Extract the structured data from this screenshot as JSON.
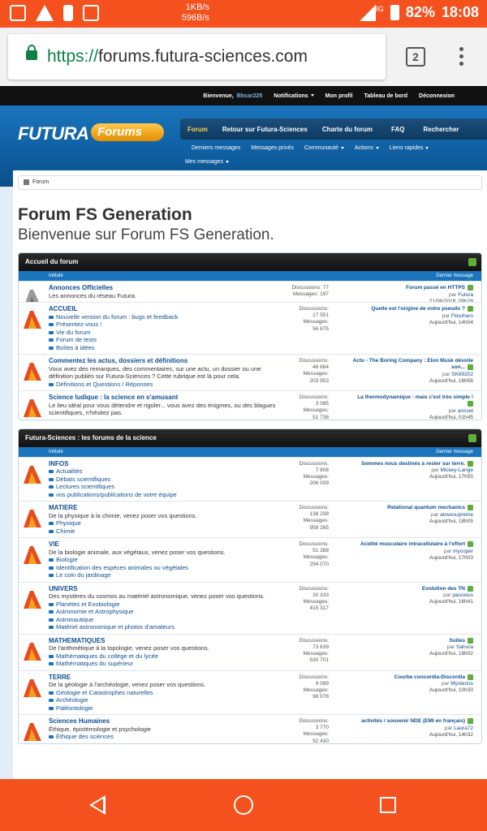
{
  "status": {
    "net_up": "1KB/s",
    "net_down": "596B/s",
    "network": "3G",
    "battery": "82%",
    "time": "18:08"
  },
  "browser": {
    "url_scheme": "https://",
    "url_host": "forums.futura-sciences.com",
    "tab_count": "2"
  },
  "userbar": {
    "welcome": "Bienvenue,",
    "username": "Bbcar225",
    "items": [
      "Notifications",
      "Mon profil",
      "Tableau de bord",
      "Déconnexion"
    ]
  },
  "header": {
    "logo": "FUTURA",
    "logo_pill": "Forums",
    "nav": [
      "Forum",
      "Retour sur Futura-Sciences",
      "Charte du forum",
      "FAQ",
      "Rechercher"
    ],
    "subnav": [
      "Derniers messages",
      "Messages privés",
      "Communauté",
      "Actions",
      "Liens rapides"
    ],
    "subnav2": "Mes messages"
  },
  "breadcrumb": "Forum",
  "page": {
    "title": "Forum FS Generation",
    "subtitle": "Bienvenue sur Forum FS Generation."
  },
  "col_left": "Intitulé",
  "col_right": "Dernier message",
  "categories": [
    {
      "name": "Accueil du forum",
      "rows": [
        {
          "title": "Annonces Officielles",
          "desc": "Les annonces du réseau Futura.",
          "subs": [],
          "stats": [
            "Discussions: 77",
            "Messages: 197"
          ],
          "last": {
            "title": "Forum passé en HTTPS",
            "by_label": "par",
            "by": "Futura",
            "date": "21/06/2018, 09h28"
          }
        },
        {
          "title": "ACCUEIL",
          "desc": "",
          "subs": [
            "Nouvelle version du forum : bugs et feedback",
            "Présentez-vous !",
            "Vie du forum",
            "Forum de tests",
            "Boîtes à idées"
          ],
          "stats": [
            "Discussions:",
            "17 551",
            "Messages:",
            "56 675"
          ],
          "last": {
            "title": "Quelle est l'origine de votre pseudo ?",
            "by_label": "par",
            "by": "Filouharo",
            "date": "Aujourd'hui, 14h04"
          }
        },
        {
          "title": "Commentez les actus, dossiers et définitions",
          "desc": "Vous avez des remarques, des commentaires, sur une actu, un dossier ou une définition publiés sur Futura-Sciences ? Cette rubrique est là pour cela.",
          "subs": [
            "Définitions et Questions / Réponses"
          ],
          "stats": [
            "Discussions:",
            "46 664",
            "Messages:",
            "203 953"
          ],
          "last": {
            "title": "Actu - The Boring Company : Elon Musk dévoile son...",
            "by_label": "par",
            "by": "SK69202",
            "date": "Aujourd'hui, 16h56"
          }
        },
        {
          "title": "Science ludique : la science en s'amusant",
          "desc": "Le lieu idéal pour vous détendre et rigoler... vous avez des énigmes, ou des blagues scientifiques, n'hésitez pas.",
          "subs": [],
          "stats": [
            "Discussions:",
            "3 085",
            "Messages:",
            "51 738"
          ],
          "last": {
            "title": "La thermodynamique : mais c'est très simple !",
            "by_label": "par",
            "by": "ansset",
            "date": "Aujourd'hui, 01h45"
          }
        }
      ]
    },
    {
      "name": "Futura-Sciences : les forums de la science",
      "rows": [
        {
          "title": "INFOS",
          "desc": "",
          "subs": [
            "Actualités",
            "Débats scientifiques",
            "Lectures scientifiques",
            "vos publications/publications de votre équipe"
          ],
          "stats": [
            "Discussions:",
            "7 806",
            "Messages:",
            "206 009"
          ],
          "last": {
            "title": "Sommes nous destinés à rester sur terre.",
            "by_label": "par",
            "by": "Mickey-Lange",
            "date": "Aujourd'hui, 17h55"
          }
        },
        {
          "title": "MATIERE",
          "desc": "De la physique à la chimie, venez poser vos questions.",
          "subs": [
            "Physique",
            "Chimie"
          ],
          "stats": [
            "Discussions:",
            "138 208",
            "Messages:",
            "958 265"
          ],
          "last": {
            "title": "Relational quantum mechanics",
            "by_label": "par",
            "by": "alovesupreme",
            "date": "Aujourd'hui, 18h05"
          }
        },
        {
          "title": "VIE",
          "desc": "De la biologie animale, aux végétaux, venez poser vos questions.",
          "subs": [
            "Biologie",
            "Identification des espèces animales ou végétales",
            "Le coin du jardinage"
          ],
          "stats": [
            "Discussions:",
            "51 388",
            "Messages:",
            "294 070"
          ],
          "last": {
            "title": "Acidité musculaire intracellulaire à l'effort",
            "by_label": "par",
            "by": "mycoper",
            "date": "Aujourd'hui, 17h03"
          }
        },
        {
          "title": "UNIVERS",
          "desc": "Des mystères du cosmos au matériel astronomique, venez poser vos questions.",
          "subs": [
            "Planètes et Exobiologie",
            "Astronomie et Astrophysique",
            "Astronautique",
            "Matériel astronomique et photos d'amateurs"
          ],
          "stats": [
            "Discussions:",
            "30 333",
            "Messages:",
            "415 317"
          ],
          "last": {
            "title": "Evolution des TN",
            "by_label": "par",
            "by": "pasceius",
            "date": "Aujourd'hui, 16h41"
          }
        },
        {
          "title": "MATHEMATIQUES",
          "desc": "De l'arithmétique à la topologie, venez poser vos questions.",
          "subs": [
            "Mathématiques du collège et du lycée",
            "Mathématiques du supérieur"
          ],
          "stats": [
            "Discussions:",
            "73 639",
            "Messages:",
            "530 701"
          ],
          "last": {
            "title": "Suites",
            "by_label": "par",
            "by": "Sahura",
            "date": "Aujourd'hui, 18h02"
          }
        },
        {
          "title": "TERRE",
          "desc": "De la géologie à l'archéologie, venez poser vos questions.",
          "subs": [
            "Géologie et Catastrophes naturelles",
            "Archéologie",
            "Paléontologie"
          ],
          "stats": [
            "Discussions:",
            "9 089",
            "Messages:",
            "98 978"
          ],
          "last": {
            "title": "Courbe concordia-Discordia",
            "by_label": "par",
            "by": "Mysterios",
            "date": "Aujourd'hui, 10h30"
          }
        },
        {
          "title": "Sciences Humaines",
          "desc": "Éthique, épistémologie et psychologie",
          "subs": [
            "Éthique des sciences"
          ],
          "stats": [
            "Discussions:",
            "3 770",
            "Messages:",
            "92 430"
          ],
          "last": {
            "title": "activités / souvenir NDE (EMI en français)",
            "by_label": "par",
            "by": "Laura72",
            "date": "Aujourd'hui, 14h32"
          }
        }
      ]
    }
  ],
  "colors": {
    "status_bar": "#f4511e",
    "site_blue": "#1a75bc",
    "link": "#0d4f8f",
    "accent_green": "#5fae3c"
  }
}
